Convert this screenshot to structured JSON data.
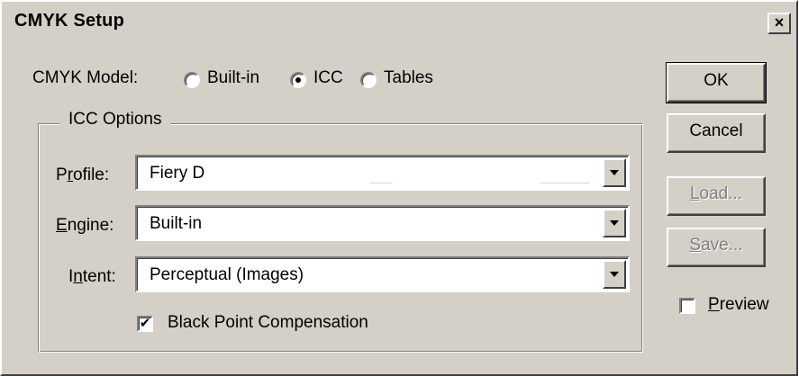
{
  "window": {
    "title": "CMYK Setup",
    "close_glyph": "×"
  },
  "cmyk_model": {
    "label": "CMYK Model:",
    "options": [
      "Built-in",
      "ICC",
      "Tables"
    ],
    "selected": "ICC"
  },
  "icc_options": {
    "group_title": "ICC Options",
    "profile": {
      "label_pre": "P",
      "label_mn": "r",
      "label_post": "ofile:",
      "value": "Fiery D"
    },
    "engine": {
      "label_pre": "",
      "label_mn": "E",
      "label_post": "ngine:",
      "value": "Built-in"
    },
    "intent": {
      "label_pre": "I",
      "label_mn": "n",
      "label_post": "tent:",
      "value": "Perceptual (Images)"
    },
    "black_point": {
      "label": "Black Point Compensation",
      "checked": true
    }
  },
  "buttons": {
    "ok": "OK",
    "cancel": "Cancel",
    "load_mn": "L",
    "load_rest": "oad...",
    "save_mn": "S",
    "save_rest": "ave..."
  },
  "preview": {
    "label_mn": "P",
    "label_rest": "review",
    "checked": false
  }
}
